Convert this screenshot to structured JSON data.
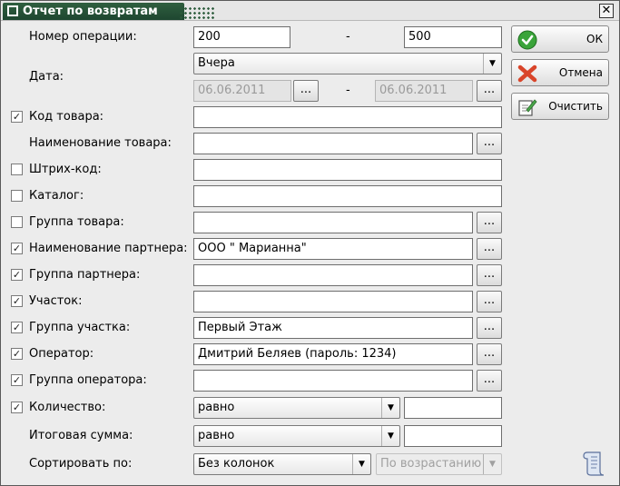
{
  "window": {
    "title": "Отчет по возвратам",
    "close_glyph": "✕"
  },
  "form": {
    "operation_number": {
      "label": "Номер операции:",
      "from": "200",
      "separator": "-",
      "to": "500"
    },
    "date": {
      "label": "Дата:",
      "period": "Вчера",
      "from": "06.06.2011",
      "separator": "-",
      "to": "06.06.2011",
      "browse": "..."
    },
    "rows": [
      {
        "label": "Код товара:",
        "checked": true,
        "value": ""
      },
      {
        "label": "Наименование товара:",
        "value": "",
        "browse": "..."
      },
      {
        "label": "Штрих-код:",
        "checked": false,
        "value": ""
      },
      {
        "label": "Каталог:",
        "checked": false,
        "value": ""
      },
      {
        "label": "Группа товара:",
        "checked": false,
        "value": "",
        "browse": "..."
      },
      {
        "label": "Наименование партнера:",
        "checked": true,
        "value": "ООО \" Марианна\"",
        "browse": "..."
      },
      {
        "label": "Группа партнера:",
        "checked": true,
        "value": "",
        "browse": "..."
      },
      {
        "label": "Участок:",
        "checked": true,
        "value": "",
        "browse": "..."
      },
      {
        "label": "Группа участка:",
        "checked": true,
        "value": "Первый Этаж",
        "browse": "..."
      },
      {
        "label": "Оператор:",
        "checked": true,
        "value": "Дмитрий Беляев (пароль: 1234)",
        "browse": "..."
      },
      {
        "label": "Группа оператора:",
        "checked": true,
        "value": "",
        "browse": "..."
      }
    ],
    "quantity": {
      "label": "Количество:",
      "checked": true,
      "condition": "равно",
      "value": ""
    },
    "total_sum": {
      "label": "Итоговая сумма:",
      "condition": "равно",
      "value": ""
    },
    "sort": {
      "label": "Сортировать по:",
      "column": "Без колонок",
      "order": "По возрастанию"
    },
    "check_glyph": "✓"
  },
  "buttons": {
    "ok": "ОК",
    "cancel": "Отмена",
    "clear": "Очистить"
  },
  "colors": {
    "title_bg": "#1e4630",
    "ok_icon": "#3aa43a",
    "cancel_icon": "#d9452a"
  }
}
